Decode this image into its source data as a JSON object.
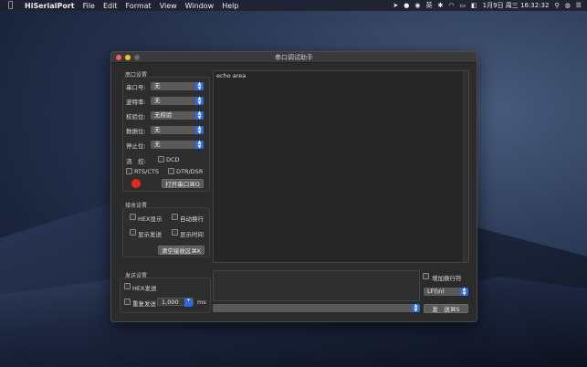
{
  "menubar": {
    "app": "HiSerialPort",
    "file": "File",
    "edit": "Edit",
    "format": "Format",
    "view": "View",
    "window": "Window",
    "help": "Help",
    "ime": "英",
    "datetime": "1月9日 周三 16:32:32"
  },
  "window": {
    "title": "串口调试助手"
  },
  "port_settings": {
    "title": "串口设置",
    "port_label": "串口号:",
    "port_value": "无",
    "baud_label": "波特率:",
    "baud_value": "无",
    "parity_label": "校验位:",
    "parity_value": "无校验",
    "databits_label": "数据位:",
    "databits_value": "无",
    "stopbits_label": "停止位:",
    "stopbits_value": "无",
    "flow_label": "流　控:",
    "dcd": "DCD",
    "rtscts": "RTS/CTS",
    "dtrdsr": "DTR/DSR",
    "open_button": "打开串口⌘O",
    "status_color": "#e8281e"
  },
  "receive_settings": {
    "title": "接收设置",
    "hex_display": "HEX显示",
    "auto_newline": "自动换行",
    "show_send": "显示发送",
    "show_time": "显示时间",
    "clear_button": "清空接收区⌘K"
  },
  "echo": {
    "label": "echo area"
  },
  "send_settings": {
    "title": "发送设置",
    "hex_send": "HEX发送",
    "repeat_send": "重复发送",
    "interval": "1,000",
    "unit": "ms"
  },
  "right_panel": {
    "add_newline": "增加换行符",
    "newline_value": "LF(\\n)",
    "send_button": "发　送⌘S"
  }
}
